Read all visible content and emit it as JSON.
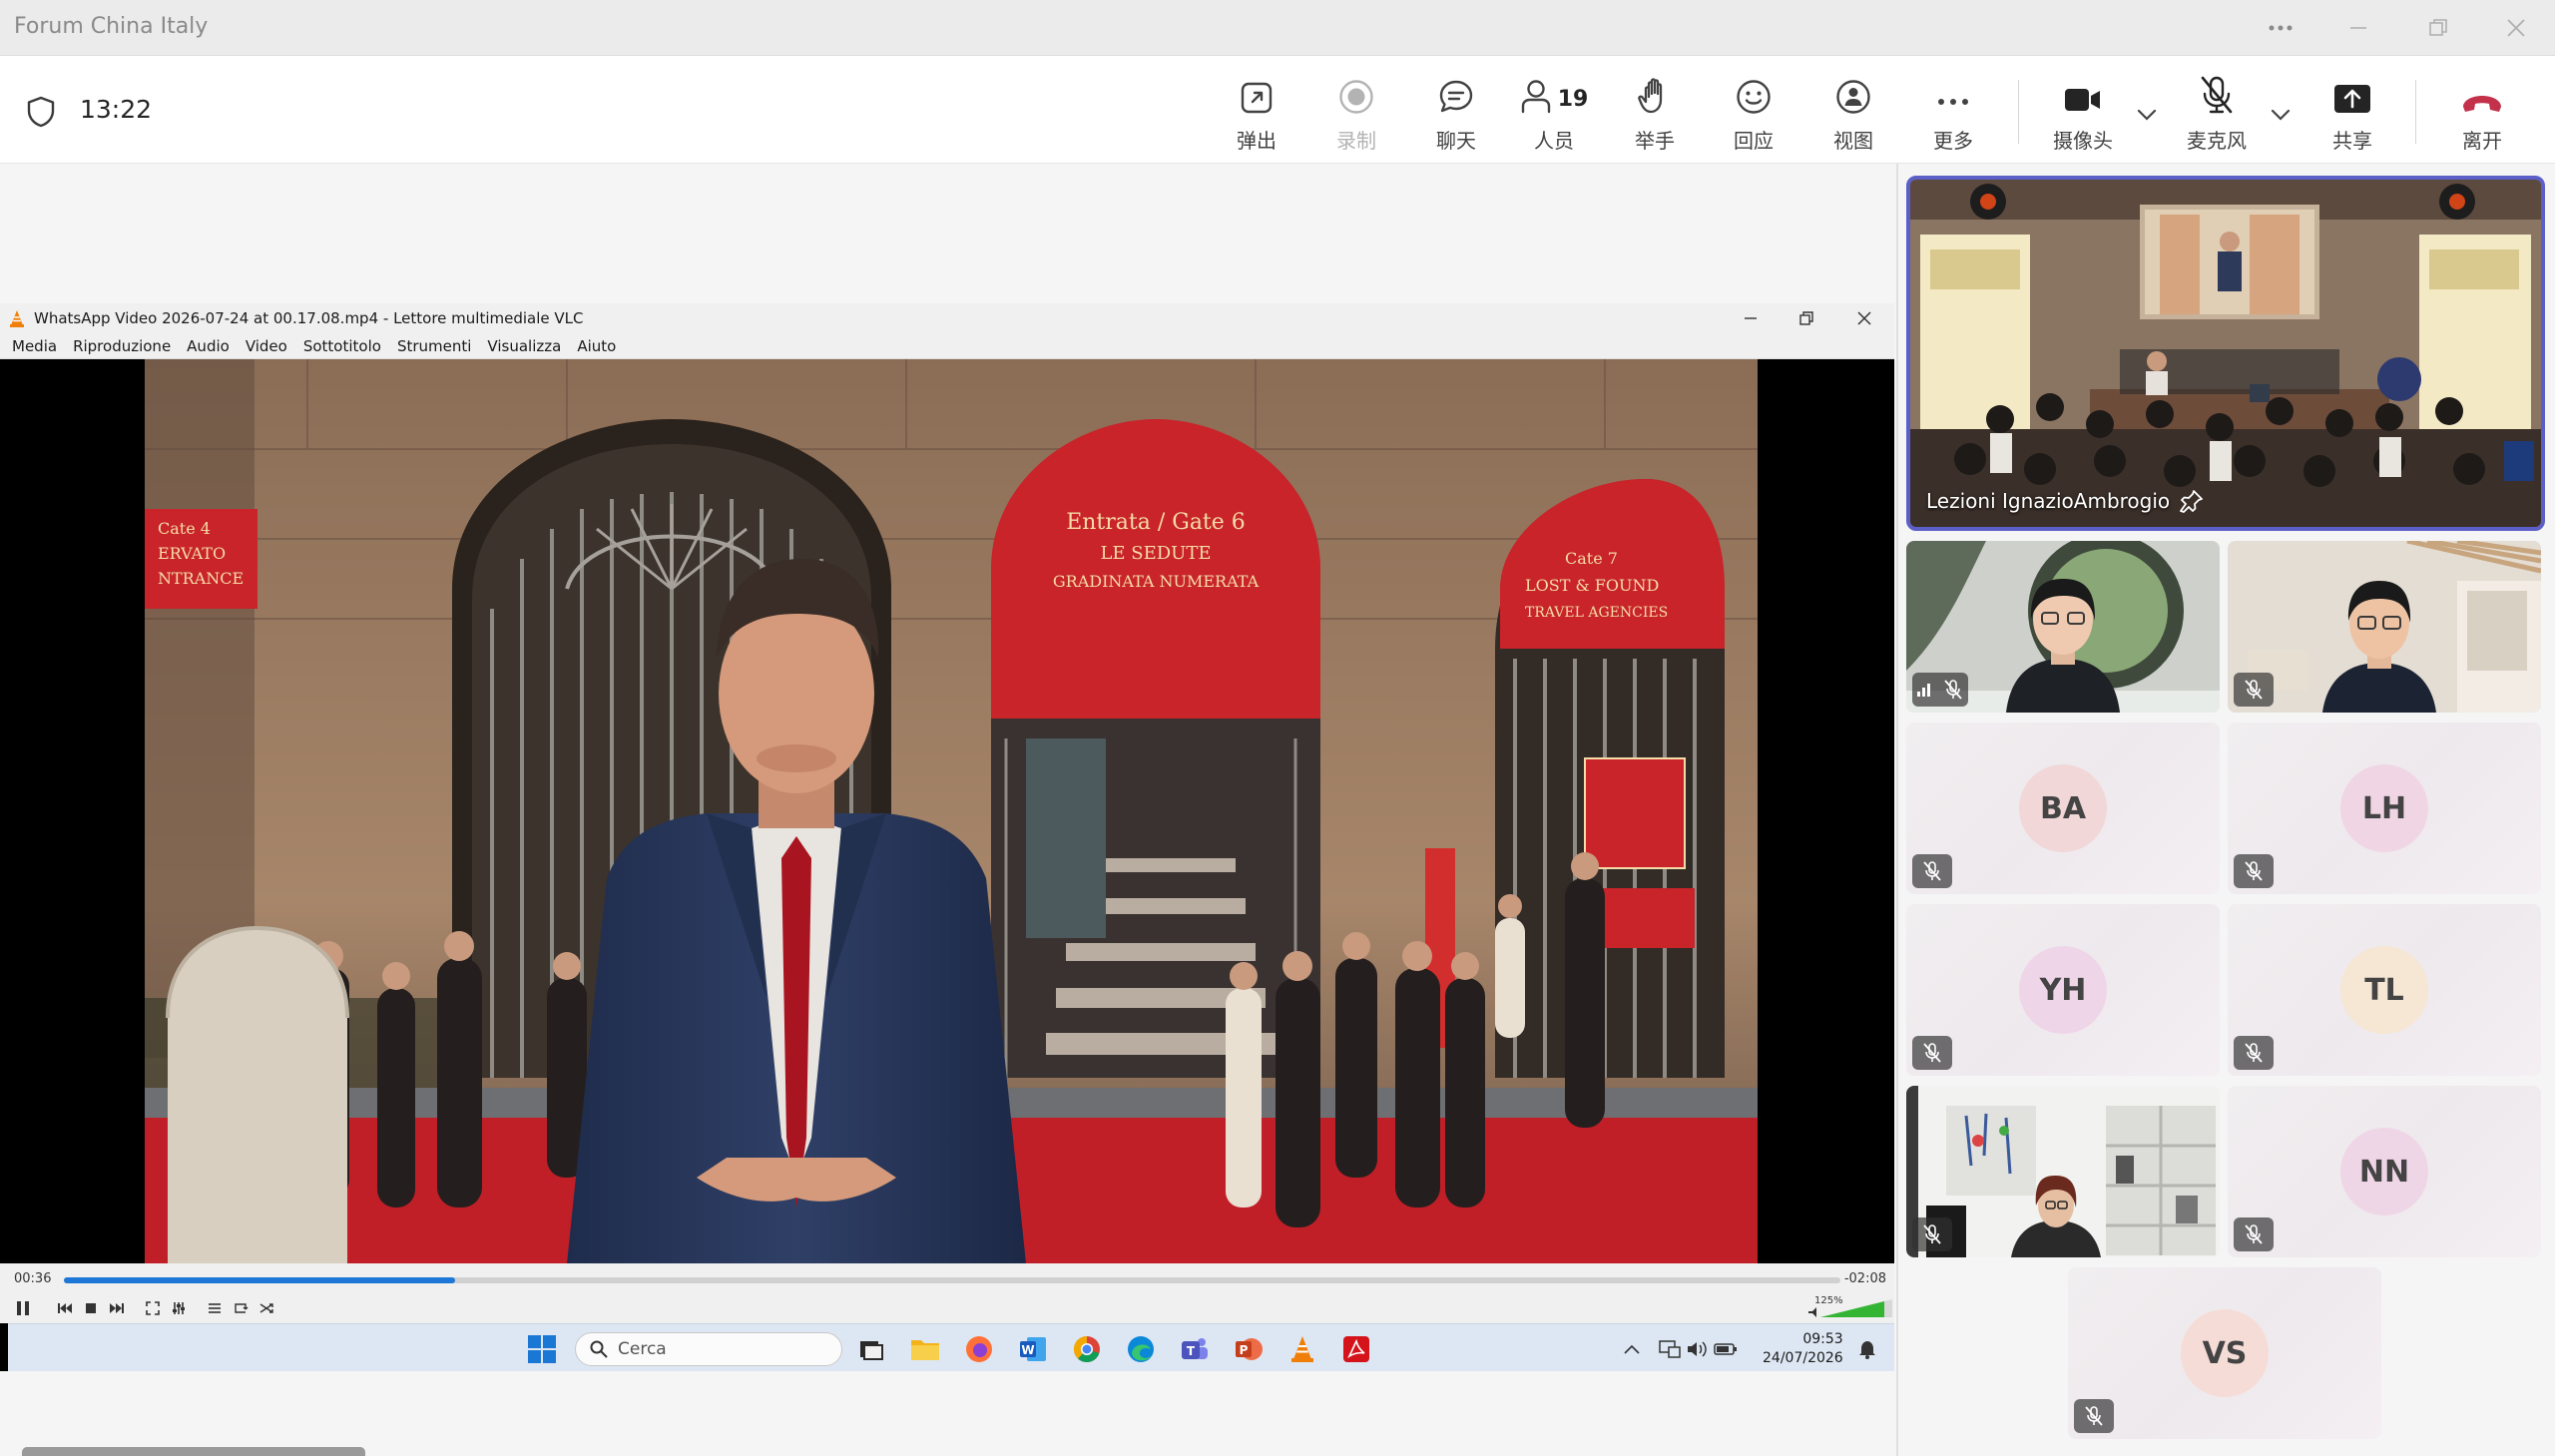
{
  "window": {
    "title": "Forum China Italy",
    "controls": [
      "more-icon",
      "minimize-icon",
      "maximize-icon",
      "close-icon"
    ]
  },
  "meeting_toolbar": {
    "timer": "13:22",
    "buttons": {
      "popout": "弹出",
      "record": "录制",
      "chat": "聊天",
      "people": "人员",
      "people_count": "19",
      "raise_hand": "举手",
      "react": "回应",
      "view": "视图",
      "more": "更多",
      "camera": "摄像头",
      "mic": "麦克风",
      "share": "共享",
      "leave": "离开"
    },
    "accent_color": "#5b5fc7",
    "leave_color": "#c4314b"
  },
  "vlc": {
    "title": "WhatsApp Video 2026-07-24 at 00.17.08.mp4 - Lettore multimediale VLC",
    "menu": [
      "Media",
      "Riproduzione",
      "Audio",
      "Video",
      "Sottotitolo",
      "Strumenti",
      "Visualizza",
      "Aiuto"
    ],
    "time_elapsed": "00:36",
    "time_remaining": "-02:08",
    "progress": 0.22,
    "volume": "125%",
    "scene": {
      "banner_left_lines": [
        "Cate 4",
        "ERVATO",
        "NTRANCE"
      ],
      "banner_center_lines": [
        "Entrata / Gate 6",
        "LE SEDUTE",
        "GRADINATA NUMERATA"
      ],
      "banner_right_lines": [
        "Cate 7",
        "LOST & FOUND",
        "TRAVEL AGENCIES"
      ]
    }
  },
  "taskbar": {
    "search_placeholder": "Cerca",
    "clock_time": "09:53",
    "clock_date": "24/07/2026"
  },
  "gallery": {
    "pinned_name": "Lezioni IgnazioAmbrogio",
    "participants": [
      {
        "id": "video-woman-glasses",
        "initials": ""
      },
      {
        "id": "video-man-glasses",
        "initials": ""
      },
      {
        "id": "ba",
        "initials": "BA",
        "color": "#f1d7d8"
      },
      {
        "id": "lh",
        "initials": "LH",
        "color": "#f0d6e4"
      },
      {
        "id": "yh",
        "initials": "YH",
        "color": "#efd5e8"
      },
      {
        "id": "tl",
        "initials": "TL",
        "color": "#f6e7d4"
      },
      {
        "id": "video-woman-office",
        "initials": ""
      },
      {
        "id": "nn",
        "initials": "NN",
        "color": "#efd6e6"
      },
      {
        "id": "vs",
        "initials": "VS",
        "color": "#f6dcd6"
      }
    ]
  }
}
